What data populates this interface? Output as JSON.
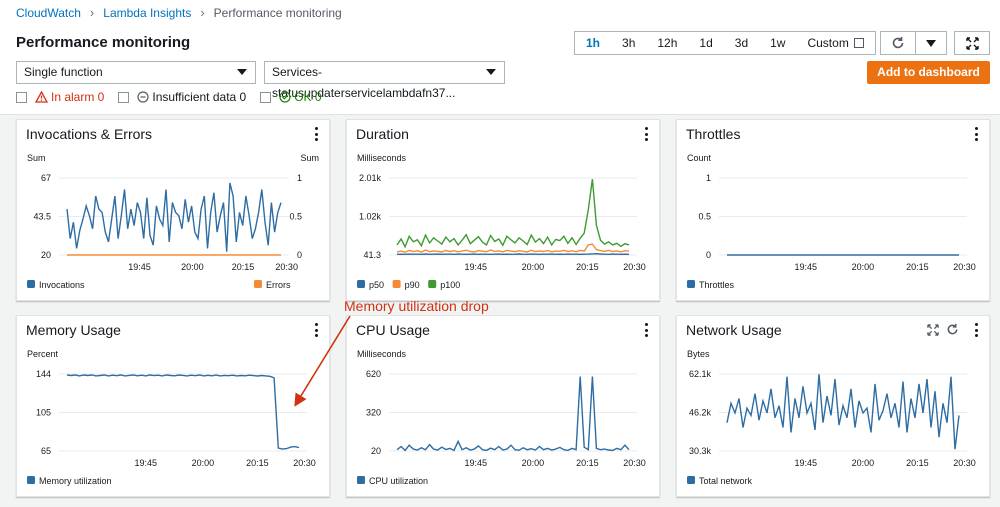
{
  "breadcrumb": [
    "CloudWatch",
    "Lambda Insights",
    "Performance monitoring"
  ],
  "page_title": "Performance monitoring",
  "time_ranges": [
    "1h",
    "3h",
    "12h",
    "1d",
    "3d",
    "1w",
    "Custom"
  ],
  "active_time_range": "1h",
  "toolbar": {
    "refresh_icon": "refresh-icon",
    "dropdown_icon": "caret-down-icon",
    "fullscreen_icon": "fullscreen-icon"
  },
  "mode_select": {
    "value": "Single function"
  },
  "function_select": {
    "value": "Services-statusupdaterservicelambdafn37..."
  },
  "add_button": "Add to dashboard",
  "filters": {
    "in_alarm": "In alarm 0",
    "insufficient": "Insufficient data 0",
    "ok": "OK 0"
  },
  "colors": {
    "blue": "#2e6da4",
    "orange": "#f68b35",
    "green": "#3e9b31",
    "accent": "#ec7211",
    "link": "#0073bb",
    "alarm": "#d13212",
    "ok": "#1d8102"
  },
  "annotation": "Memory utilization drop",
  "panels": [
    {
      "title": "Invocations & Errors",
      "chart_data": {
        "type": "line",
        "ylabel": "Sum",
        "y2label": "Sum",
        "yticks": [
          "67",
          "43.5",
          "20"
        ],
        "y2ticks": [
          "1",
          "0.5",
          "0"
        ],
        "ylim": [
          20,
          67
        ],
        "xticks": [
          "19:45",
          "20:00",
          "20:15",
          "20:30"
        ],
        "series": [
          {
            "name": "Invocations",
            "color": "#2e6da4",
            "axis": "left",
            "values": [
              48,
              30,
              40,
              24,
              35,
              42,
              50,
              44,
              36,
              56,
              48,
              46,
              34,
              28,
              42,
              56,
              30,
              44,
              60,
              36,
              48,
              38,
              52,
              46,
              30,
              55,
              32,
              26,
              50,
              42,
              38,
              60,
              28,
              52,
              46,
              44,
              36,
              54,
              40,
              50,
              34,
              30,
              48,
              56,
              24,
              46,
              58,
              34,
              44,
              52,
              22,
              64,
              56,
              28,
              46,
              38,
              56,
              44,
              30,
              36,
              46,
              60,
              40,
              26,
              52,
              34,
              46,
              52
            ]
          },
          {
            "name": "Errors",
            "color": "#f68b35",
            "axis": "right",
            "values": [
              0,
              0,
              0,
              0,
              0,
              0,
              0,
              0,
              0,
              0,
              0,
              0,
              0,
              0,
              0,
              0,
              0,
              0,
              0,
              0,
              0,
              0,
              0,
              0,
              0,
              0,
              0,
              0,
              0,
              0,
              0,
              0,
              0,
              0,
              0,
              0,
              0,
              0,
              0,
              0
            ]
          }
        ]
      }
    },
    {
      "title": "Duration",
      "chart_data": {
        "type": "line",
        "ylabel": "Milliseconds",
        "yticks": [
          "2.01k",
          "1.02k",
          "41.3"
        ],
        "ylim": [
          41.3,
          2010
        ],
        "xticks": [
          "19:45",
          "20:00",
          "20:15",
          "20:30"
        ],
        "series": [
          {
            "name": "p50",
            "color": "#2e6da4",
            "values": [
              60,
              62,
              58,
              65,
              61,
              63,
              59,
              66,
              60,
              62,
              64,
              58,
              61,
              63,
              60,
              65,
              62,
              59,
              61,
              64,
              60,
              63,
              61,
              58,
              62,
              65,
              60,
              63,
              59,
              62,
              66,
              61,
              60,
              64,
              62,
              59,
              63,
              61,
              65,
              60,
              62,
              58,
              64,
              61,
              63,
              60,
              62,
              65,
              70,
              75,
              66,
              62,
              60,
              64,
              61,
              59,
              63,
              60
            ]
          },
          {
            "name": "p90",
            "color": "#f68b35",
            "values": [
              120,
              140,
              110,
              160,
              130,
              150,
              115,
              170,
              125,
              145,
              135,
              118,
              160,
              128,
              150,
              122,
              140,
              165,
              130,
              118,
              155,
              138,
              125,
              170,
              132,
              148,
              120,
              160,
              140,
              126,
              152,
              135,
              118,
              165,
              128,
              145,
              130,
              155,
              122,
              140,
              136,
              160,
              130,
              148,
              125,
              158,
              140,
              300,
              320,
              180,
              150,
              135,
              160,
              130,
              145,
              120,
              150,
              138
            ]
          },
          {
            "name": "p100",
            "color": "#3e9b31",
            "values": [
              300,
              450,
              250,
              520,
              380,
              430,
              280,
              550,
              350,
              480,
              400,
              320,
              500,
              380,
              460,
              300,
              420,
              560,
              330,
              420,
              510,
              370,
              300,
              540,
              390,
              450,
              290,
              520,
              430,
              350,
              480,
              400,
              310,
              550,
              370,
              460,
              330,
              500,
              300,
              440,
              410,
              520,
              340,
              480,
              310,
              470,
              600,
              1200,
              1980,
              800,
              420,
              320,
              380,
              300,
              340,
              260,
              330,
              300
            ]
          }
        ]
      }
    },
    {
      "title": "Throttles",
      "chart_data": {
        "type": "line",
        "ylabel": "Count",
        "yticks": [
          "1",
          "0.5",
          "0"
        ],
        "ylim": [
          0,
          1
        ],
        "xticks": [
          "19:45",
          "20:00",
          "20:15",
          "20:30"
        ],
        "series": [
          {
            "name": "Throttles",
            "color": "#2e6da4",
            "values": [
              0,
              0,
              0,
              0,
              0,
              0,
              0,
              0,
              0,
              0,
              0,
              0,
              0,
              0,
              0,
              0,
              0,
              0,
              0,
              0
            ]
          }
        ]
      }
    },
    {
      "title": "Memory Usage",
      "chart_data": {
        "type": "line",
        "ylabel": "Percent",
        "yticks": [
          "144",
          "105",
          "65"
        ],
        "ylim": [
          65,
          144
        ],
        "xticks": [
          "19:45",
          "20:00",
          "20:15",
          "20:30"
        ],
        "series": [
          {
            "name": "Memory utilization",
            "color": "#2e6da4",
            "values": [
              143,
              142.5,
              143,
              142,
              143,
              142.5,
              143,
              142,
              142.5,
              143,
              142,
              142.8,
              142.3,
              143,
              142,
              142.6,
              143,
              142.2,
              142.8,
              142,
              143,
              142.4,
              142.8,
              142,
              143,
              142.5,
              142.2,
              143,
              142.6,
              142,
              142.8,
              142.3,
              143,
              142.1,
              142.7,
              142.2,
              142.9,
              142,
              142.6,
              142.3,
              142.8,
              142,
              142.5,
              142.2,
              142.8,
              142.4,
              141.9,
              142.5,
              142,
              141.6,
              140,
              68,
              67,
              67.5,
              69,
              69.5,
              68.5
            ]
          }
        ]
      }
    },
    {
      "title": "CPU Usage",
      "chart_data": {
        "type": "line",
        "ylabel": "Milliseconds",
        "yticks": [
          "620",
          "320",
          "20"
        ],
        "ylim": [
          20,
          620
        ],
        "xticks": [
          "19:45",
          "20:00",
          "20:15",
          "20:30"
        ],
        "series": [
          {
            "name": "CPU utilization",
            "color": "#2e6da4",
            "values": [
              30,
              55,
              25,
              65,
              35,
              28,
              45,
              30,
              70,
              35,
              28,
              50,
              32,
              40,
              25,
              95,
              30,
              45,
              28,
              35,
              60,
              30,
              25,
              42,
              30,
              55,
              28,
              35,
              65,
              30,
              26,
              45,
              30,
              38,
              28,
              55,
              30,
              40,
              28,
              35,
              48,
              30,
              25,
              40,
              30,
              600,
              50,
              30,
              600,
              40,
              30,
              35,
              28,
              25,
              40,
              30,
              65,
              30
            ]
          }
        ]
      }
    },
    {
      "title": "Network Usage",
      "chart_data": {
        "type": "line",
        "ylabel": "Bytes",
        "yticks": [
          "62.1k",
          "46.2k",
          "30.3k"
        ],
        "ylim": [
          30300,
          62100
        ],
        "xticks": [
          "19:45",
          "20:00",
          "20:15",
          "20:30"
        ],
        "series": [
          {
            "name": "Total network",
            "color": "#2e6da4",
            "values": [
              42000,
              50000,
              46000,
              52000,
              40000,
              48000,
              45000,
              54000,
              43000,
              51000,
              46000,
              56000,
              44000,
              49000,
              40000,
              61000,
              38000,
              52000,
              44000,
              57000,
              46000,
              50000,
              39000,
              62000,
              42000,
              53000,
              45000,
              60000,
              41000,
              49000,
              44000,
              56000,
              40000,
              51000,
              46000,
              48000,
              38000,
              58000,
              43000,
              47000,
              54000,
              44000,
              50000,
              40000,
              59000,
              38000,
              52000,
              44000,
              58000,
              46000,
              60000,
              40000,
              55000,
              36000,
              50000,
              42000,
              61000,
              31000,
              45000
            ]
          }
        ]
      }
    }
  ]
}
